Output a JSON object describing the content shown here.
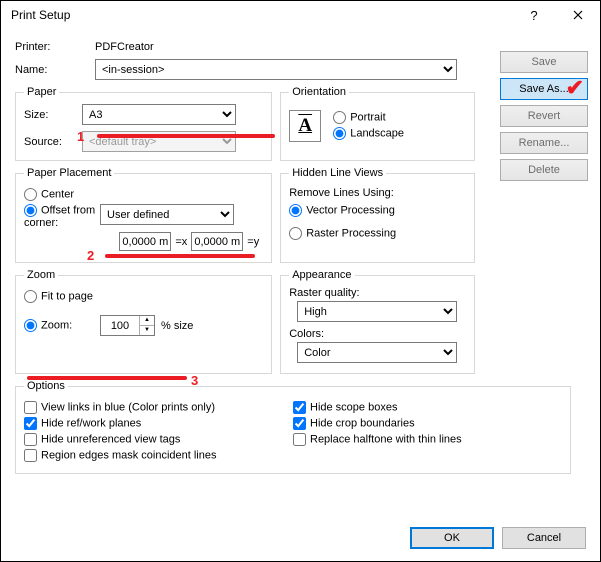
{
  "window": {
    "title": "Print Setup"
  },
  "printer": {
    "label": "Printer:",
    "value": "PDFCreator"
  },
  "name": {
    "label": "Name:",
    "value": "<in-session>"
  },
  "actions": {
    "save": "Save",
    "saveAs": "Save As...",
    "revert": "Revert",
    "rename": "Rename...",
    "delete": "Delete"
  },
  "paper": {
    "legend": "Paper",
    "sizeLabel": "Size:",
    "sizeValue": "A3",
    "sourceLabel": "Source:",
    "sourceValue": "<default tray>"
  },
  "orientation": {
    "legend": "Orientation",
    "portrait": "Portrait",
    "landscape": "Landscape",
    "icon": "A"
  },
  "placement": {
    "legend": "Paper Placement",
    "center": "Center",
    "offset": "Offset from corner:",
    "preset": "User defined",
    "x": "0,0000 m",
    "xSuffix": "=x",
    "y": "0,0000 m",
    "ySuffix": "=y"
  },
  "hidden": {
    "legend": "Hidden Line Views",
    "removeLabel": "Remove Lines Using:",
    "vector": "Vector Processing",
    "raster": "Raster Processing"
  },
  "zoom": {
    "legend": "Zoom",
    "fit": "Fit to page",
    "zoom": "Zoom:",
    "value": "100",
    "suffix": "% size"
  },
  "appearance": {
    "legend": "Appearance",
    "rasterLabel": "Raster quality:",
    "rasterValue": "High",
    "colorsLabel": "Colors:",
    "colorsValue": "Color"
  },
  "options": {
    "legend": "Options",
    "viewLinks": "View links in blue (Color prints only)",
    "hideRef": "Hide ref/work planes",
    "hideUnref": "Hide unreferenced view tags",
    "regionEdges": "Region edges mask coincident lines",
    "hideScope": "Hide scope boxes",
    "hideCrop": "Hide crop boundaries",
    "replaceHalftone": "Replace halftone with thin lines"
  },
  "footer": {
    "ok": "OK",
    "cancel": "Cancel"
  },
  "annot": {
    "1": "1",
    "2": "2",
    "3": "3"
  }
}
